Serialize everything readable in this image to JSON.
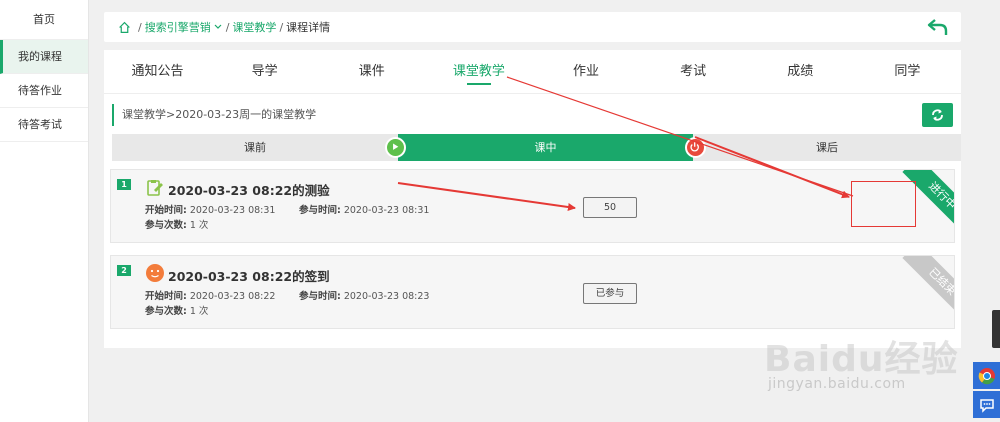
{
  "sidebar": {
    "items": [
      {
        "label": "首页"
      },
      {
        "label": "我的课程"
      },
      {
        "label": "待答作业"
      },
      {
        "label": "待答考试"
      }
    ]
  },
  "breadcrumb": {
    "items": [
      "搜索引擎营销",
      "课堂教学"
    ],
    "current": "课程详情"
  },
  "tabs": [
    "通知公告",
    "导学",
    "课件",
    "课堂教学",
    "作业",
    "考试",
    "成绩",
    "同学"
  ],
  "sub_title": "课堂教学>2020-03-23周一的课堂教学",
  "phases": [
    "课前",
    "课中",
    "课后"
  ],
  "cards": [
    {
      "num": "1",
      "title": "2020-03-23 08:22的测验",
      "start_label": "开始时间:",
      "start_time": "2020-03-23 08:31",
      "join_label": "参与时间:",
      "join_time": "2020-03-23 08:31",
      "count_label": "参与次数:",
      "count": "1 次",
      "action": "50",
      "ribbon": "进行中"
    },
    {
      "num": "2",
      "title": "2020-03-23 08:22的签到",
      "start_label": "开始时间:",
      "start_time": "2020-03-23 08:22",
      "join_label": "参与时间:",
      "join_time": "2020-03-23 08:23",
      "count_label": "参与次数:",
      "count": "1 次",
      "action": "已参与",
      "ribbon": "已结束"
    }
  ],
  "watermark": {
    "brand": "Baidu经验",
    "url": "jingyan.baidu.com"
  },
  "colors": {
    "accent": "#1aa86b",
    "annotation": "#e53935",
    "bg": "#f0f0f0"
  },
  "icons": {
    "home": "home-icon",
    "back": "back-arrow-icon",
    "refresh": "refresh-icon",
    "play": "play-icon",
    "power": "power-icon",
    "quiz": "quiz-icon",
    "signin": "signin-icon",
    "browser": "chrome-icon",
    "chat": "chat-icon"
  }
}
